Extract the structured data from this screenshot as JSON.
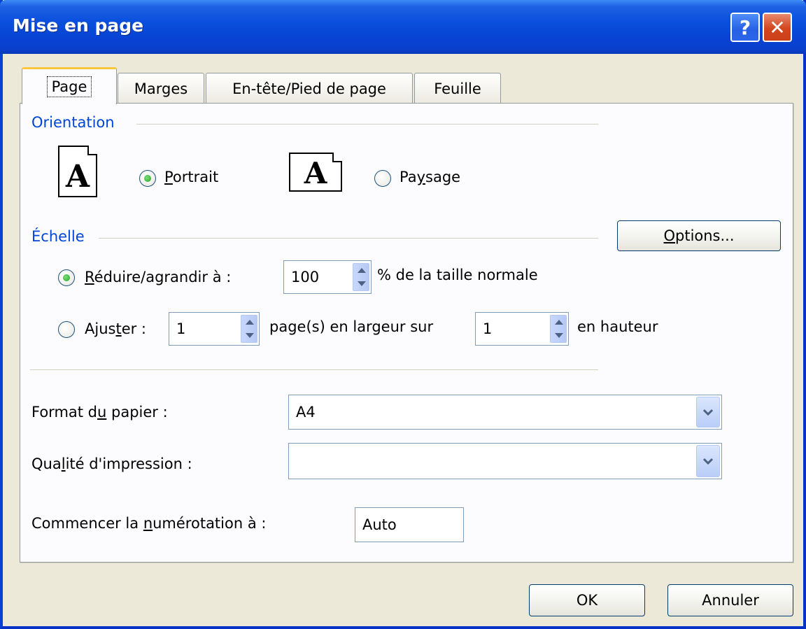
{
  "window": {
    "title": "Mise en page"
  },
  "titlebar": {
    "help_glyph": "?",
    "close_glyph": "✕"
  },
  "tabs": [
    {
      "label": "Page",
      "active": true
    },
    {
      "label": "Marges",
      "active": false
    },
    {
      "label": "En-tête/Pied de page",
      "active": false
    },
    {
      "label": "Feuille",
      "active": false
    }
  ],
  "orientation": {
    "group_label": "Orientation",
    "portrait_pre": "",
    "portrait_ul": "P",
    "portrait_post": "ortrait",
    "paysage_pre": "Pa",
    "paysage_ul": "y",
    "paysage_post": "sage",
    "icon_glyph": "A",
    "selected": "Portrait"
  },
  "echelle": {
    "group_label": "Échelle",
    "options_pre": "",
    "options_ul": "O",
    "options_post": "ptions...",
    "reduire_pre": "",
    "reduire_ul": "R",
    "reduire_post": "éduire/agrandir à :",
    "reduire_value": "100",
    "reduire_suffix": "% de la taille normale",
    "ajuster_pre": "Ajus",
    "ajuster_ul": "t",
    "ajuster_post": "er :",
    "largeur_value": "1",
    "largeur_suffix": "page(s) en largeur sur",
    "hauteur_value": "1",
    "hauteur_suffix": "en hauteur",
    "selected": "Réduire/agrandir à"
  },
  "paper": {
    "format_pre": "Format d",
    "format_ul": "u",
    "format_post": " papier :",
    "format_value": "A4",
    "quality_pre": "Qua",
    "quality_ul": "l",
    "quality_post": "ité d'impression :",
    "quality_value": "",
    "numbering_pre": "Commencer la ",
    "numbering_ul": "n",
    "numbering_post": "umérotation à :",
    "numbering_value": "Auto"
  },
  "footer": {
    "ok_label": "OK",
    "cancel_label": "Annuler"
  },
  "colors": {
    "title_blue": "#0a4fdd",
    "group_label_blue": "#0046d5",
    "close_red": "#d4461e",
    "tab_highlight": "#ffc83c"
  }
}
